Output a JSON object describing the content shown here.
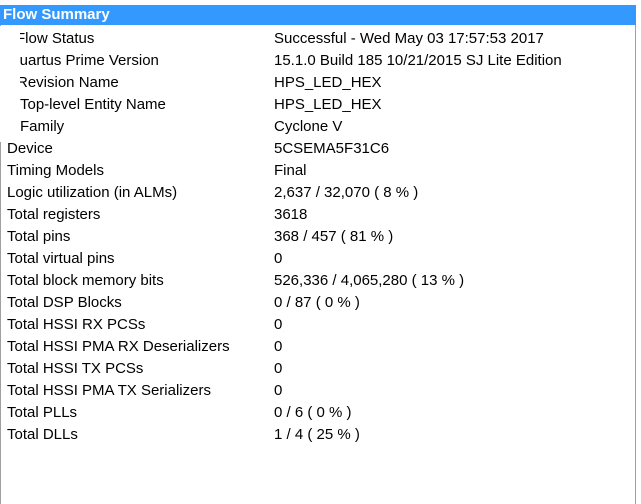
{
  "panel": {
    "title": "Flow Summary"
  },
  "rows": [
    {
      "label": "Flow Status",
      "value": "Successful - Wed May 03 17:57:53 2017"
    },
    {
      "label": "Quartus Prime Version",
      "value": "15.1.0 Build 185 10/21/2015 SJ Lite Edition"
    },
    {
      "label": "Revision Name",
      "value": "HPS_LED_HEX"
    },
    {
      "label": "Top-level Entity Name",
      "value": "HPS_LED_HEX"
    },
    {
      "label": "Family",
      "value": "Cyclone V"
    },
    {
      "label": "Device",
      "value": "5CSEMA5F31C6"
    },
    {
      "label": "Timing Models",
      "value": "Final"
    },
    {
      "label": "Logic utilization (in ALMs)",
      "value": "2,637 / 32,070 ( 8 % )"
    },
    {
      "label": "Total registers",
      "value": "3618"
    },
    {
      "label": "Total pins",
      "value": "368 / 457 ( 81 % )"
    },
    {
      "label": "Total virtual pins",
      "value": "0"
    },
    {
      "label": "Total block memory bits",
      "value": "526,336 / 4,065,280 ( 13 % )"
    },
    {
      "label": "Total DSP Blocks",
      "value": "0 / 87 ( 0 % )"
    },
    {
      "label": "Total HSSI RX PCSs",
      "value": "0"
    },
    {
      "label": "Total HSSI PMA RX Deserializers",
      "value": "0"
    },
    {
      "label": "Total HSSI TX PCSs",
      "value": "0"
    },
    {
      "label": "Total HSSI PMA TX Serializers",
      "value": "0"
    },
    {
      "label": "Total PLLs",
      "value": "0 / 6 ( 0 % )"
    },
    {
      "label": "Total DLLs",
      "value": "1 / 4 ( 25 % )"
    }
  ],
  "colors": {
    "title_bar": "#3399ff",
    "title_text": "#ffffff",
    "background": "#ffffff",
    "text": "#000000"
  }
}
